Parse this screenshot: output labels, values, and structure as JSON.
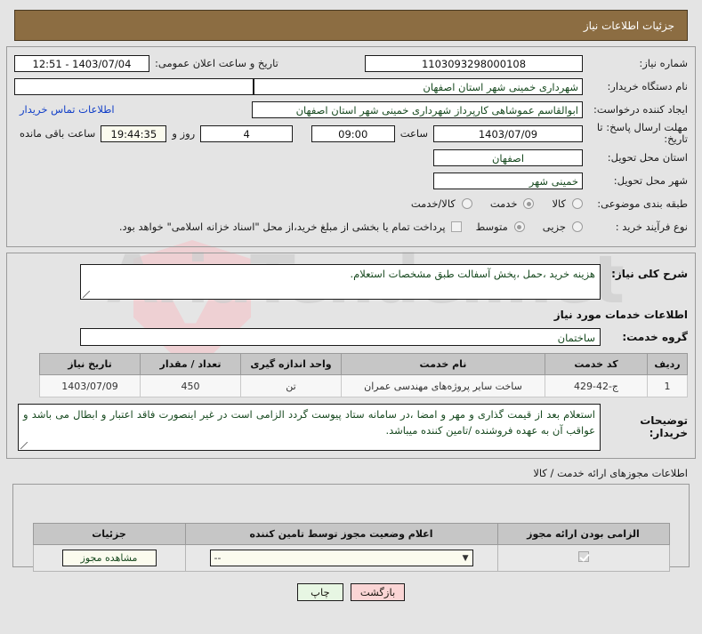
{
  "header": {
    "title": "جزئیات اطلاعات نیاز"
  },
  "form": {
    "need_number_label": "شماره نیاز:",
    "need_number_value": "1103093298000108",
    "public_announce_label": "تاریخ و ساعت اعلان عمومی:",
    "public_announce_value": "1403/07/04 - 12:51",
    "buyer_org_label": "نام دستگاه خریدار:",
    "buyer_org_value": "شهرداری خمینی شهر استان اصفهان",
    "requester_label": "ایجاد کننده درخواست:",
    "requester_value": "ابوالقاسم عموشاهی کارپرداز شهرداری خمینی شهر استان اصفهان",
    "contact_link": "اطلاعات تماس خریدار",
    "deadline_label": "مهلت ارسال پاسخ: تا تاریخ:",
    "deadline_date": "1403/07/09",
    "hour_label": "ساعت",
    "deadline_time": "09:00",
    "days_value": "4",
    "days_text": "روز و",
    "countdown_value": "19:44:35",
    "remaining_text": "ساعت باقی مانده",
    "province_label": "استان محل تحویل:",
    "province_value": "اصفهان",
    "city_label": "شهر محل تحویل:",
    "city_value": "خمینی شهر",
    "category_label": "طبقه بندی موضوعی:",
    "category_options": [
      {
        "label": "کالا",
        "selected": false
      },
      {
        "label": "خدمت",
        "selected": true
      },
      {
        "label": "کالا/خدمت",
        "selected": false
      }
    ],
    "process_label": "نوع فرآیند خرید :",
    "process_options": [
      {
        "label": "جزیی",
        "selected": false
      },
      {
        "label": "متوسط",
        "selected": true
      }
    ],
    "treasury_checkbox_checked": false,
    "treasury_text": "پرداخت تمام یا بخشی از مبلغ خرید،از محل \"اسناد خزانه اسلامی\" خواهد بود."
  },
  "description": {
    "label": "شرح کلی نیاز:",
    "value": "هزینه خرید ،حمل ،پخش آسفالت طبق مشخصات استعلام.",
    "services_section_title": "اطلاعات خدمات مورد نیاز",
    "group_label": "گروه خدمت:",
    "group_value": "ساختمان"
  },
  "items_table": {
    "columns": [
      "ردیف",
      "کد خدمت",
      "نام خدمت",
      "واحد اندازه گیری",
      "تعداد / مقدار",
      "تاریخ نیاز"
    ],
    "rows": [
      {
        "row_no": "1",
        "service_code": "ج-42-429",
        "service_name": "ساخت سایر پروژه‌های مهندسی عمران",
        "unit": "تن",
        "quantity": "450",
        "need_date": "1403/07/09"
      }
    ]
  },
  "buyer_notes": {
    "label": "توضیحات خریدار:",
    "value": "استعلام بعد از قیمت گذاری و مهر و امضا ،در سامانه ستاد پیوست گردد الزامی است در غیر اینصورت فاقد اعتبار و ابطال می باشد و عواقب آن به عهده فروشنده /تامین کننده میباشد."
  },
  "permits": {
    "heading": "اطلاعات مجوزهای ارائه خدمت / کالا",
    "columns": [
      "الزامی بودن ارائه مجوز",
      "اعلام وضعیت مجوز توسط تامین کننده",
      "جزئیات"
    ],
    "rows": [
      {
        "required_checked": true,
        "status_value": "--",
        "details_button": "مشاهده مجوز"
      }
    ]
  },
  "footer": {
    "back_button": "بازگشت",
    "print_button": "چاپ"
  },
  "watermark": {
    "text": "AriaTender.net"
  },
  "colors": {
    "header_brown": "#8c6d42",
    "link_blue": "#1340c8",
    "field_green": "#17491f",
    "back_button_bg": "#fad5d5",
    "print_button_bg": "#e7f6e3",
    "highlight_cream": "#fbfbee"
  }
}
